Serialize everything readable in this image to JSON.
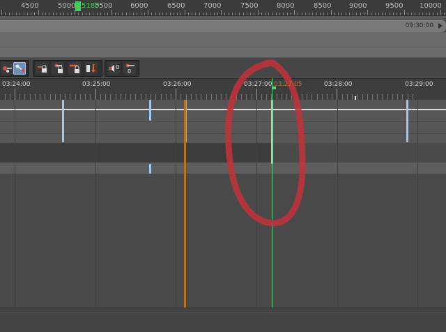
{
  "frame_ruler": {
    "labels": [
      "4500",
      "5000",
      "5500",
      "6000",
      "6500",
      "7000",
      "7500",
      "8000",
      "8500",
      "9000",
      "9500",
      "10000"
    ],
    "current_frame": "5180"
  },
  "time_strip": {
    "label": "09:30:00"
  },
  "time_ruler": {
    "labels": [
      "03:24:00",
      "03:25:00",
      "03:26:00",
      "03:27:00",
      "03:28:00",
      "03:29:00"
    ],
    "current_time": "03:27:05"
  },
  "toolbar": {
    "counter_a": "0",
    "counter_b": "0"
  },
  "colors": {
    "playhead": "#52d46e",
    "keyframe_blue": "#9fc8ef",
    "orange_marker": "#b5751f",
    "annotation_red": "#c2313a"
  },
  "icons": [
    "key-mode-icon",
    "key-mode-active-icon",
    "lock-icon",
    "lock-icon",
    "lock-icon",
    "move-down-icon",
    "speaker-key-icon",
    "key-icon"
  ]
}
